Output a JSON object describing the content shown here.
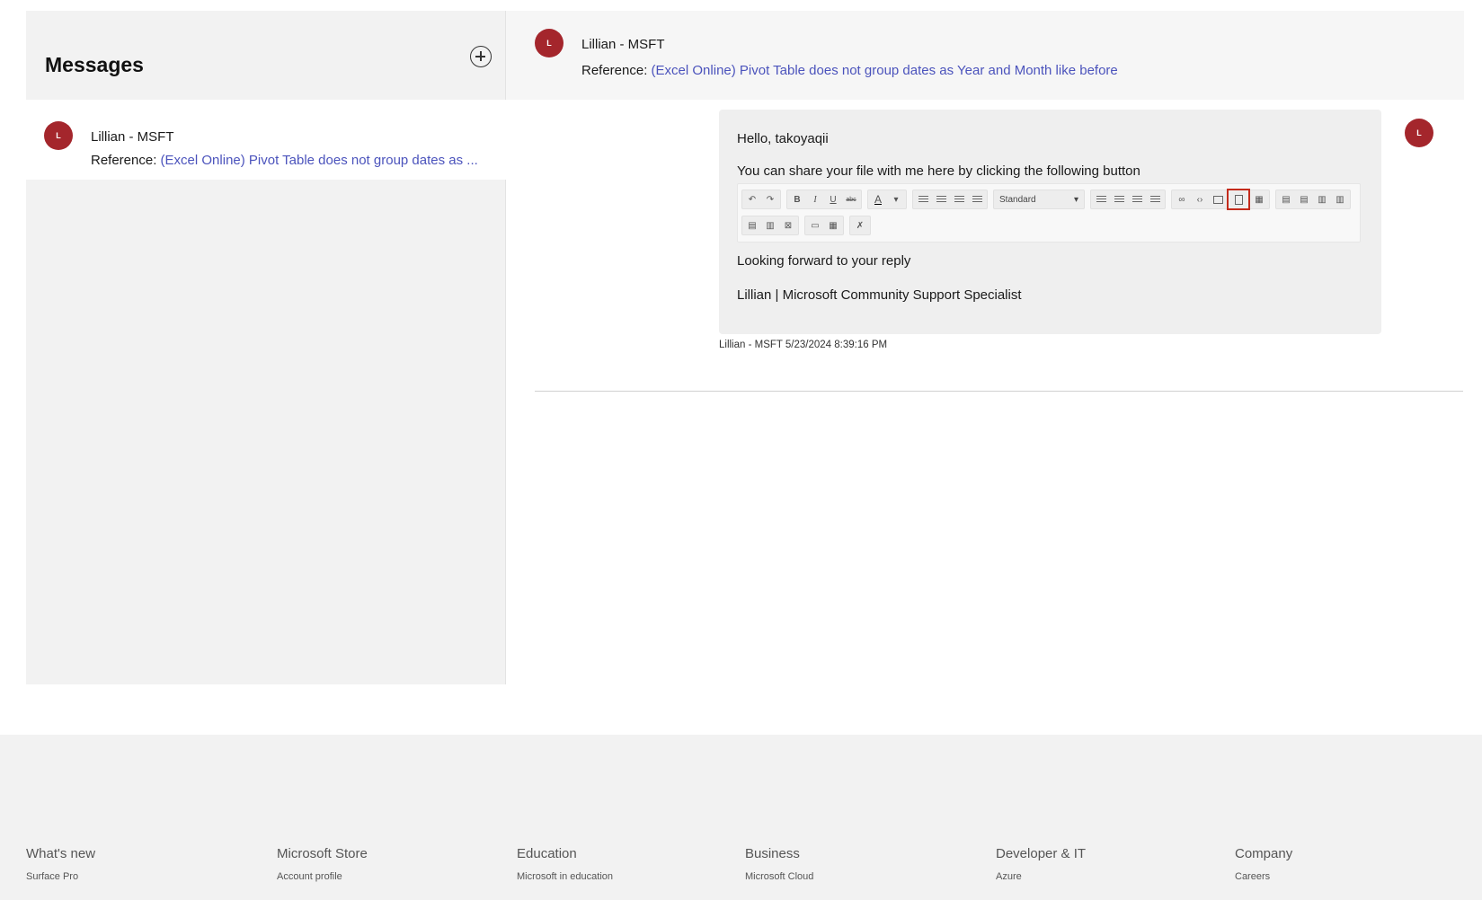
{
  "sidebar": {
    "title": "Messages",
    "conversation": {
      "avatar_initial": "L",
      "name": "Lillian - MSFT",
      "reference_label": "Reference:",
      "reference_link": "(Excel Online) Pivot Table does not group dates as ..."
    }
  },
  "thread": {
    "avatar_initial": "L",
    "name": "Lillian - MSFT",
    "reference_label": "Reference:",
    "reference_link": "(Excel Online) Pivot Table does not group dates as Year and Month like before"
  },
  "message": {
    "greeting": "Hello, takoyaqii",
    "body": "You can share your file with me here by clicking the following button",
    "closing": "Looking forward to your reply",
    "signature": "Lillian | Microsoft Community Support Specialist",
    "meta": "Lillian - MSFT 5/23/2024 8:39:16 PM",
    "avatar_initial": "L",
    "toolbar_style_value": "Standard"
  },
  "footer": {
    "columns": [
      {
        "heading": "What's new",
        "link": "Surface Pro"
      },
      {
        "heading": "Microsoft Store",
        "link": "Account profile"
      },
      {
        "heading": "Education",
        "link": "Microsoft in education"
      },
      {
        "heading": "Business",
        "link": "Microsoft Cloud"
      },
      {
        "heading": "Developer & IT",
        "link": "Azure"
      },
      {
        "heading": "Company",
        "link": "Careers"
      }
    ]
  },
  "colors": {
    "avatar": "#a4262c",
    "link": "#4b53bc",
    "highlight": "#c42b1c"
  }
}
